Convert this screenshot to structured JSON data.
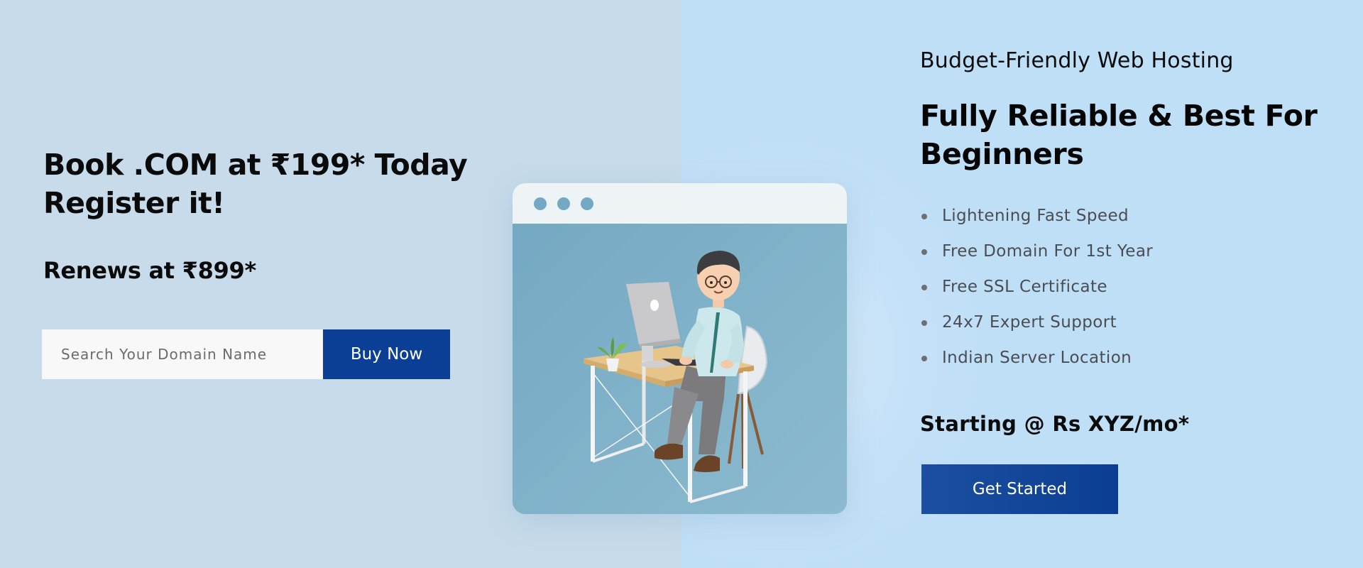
{
  "hero": {
    "headline_line1": "Book .COM at ₹199* Today",
    "headline_line2": "Register it!",
    "renews": "Renews at ₹899*",
    "search_placeholder": "Search Your Domain Name",
    "buy_label": "Buy Now"
  },
  "illustration": {
    "window_dots": [
      "dot",
      "dot",
      "dot"
    ]
  },
  "hosting": {
    "kicker": "Budget-Friendly Web Hosting",
    "title_line1": "Fully Reliable & Best For",
    "title_line2": "Beginners",
    "features": [
      "Lightening Fast Speed",
      "Free Domain For 1st Year",
      "Free SSL Certificate",
      "24x7 Expert Support",
      "Indian Server Location"
    ],
    "price": "Starting @ Rs XYZ/mo*",
    "cta_label": "Get Started"
  },
  "colors": {
    "left_bg": "#c7dbea",
    "right_bg": "#bfdff7",
    "button_blue": "#0b3f95",
    "dot_blue": "#74a9c4"
  }
}
